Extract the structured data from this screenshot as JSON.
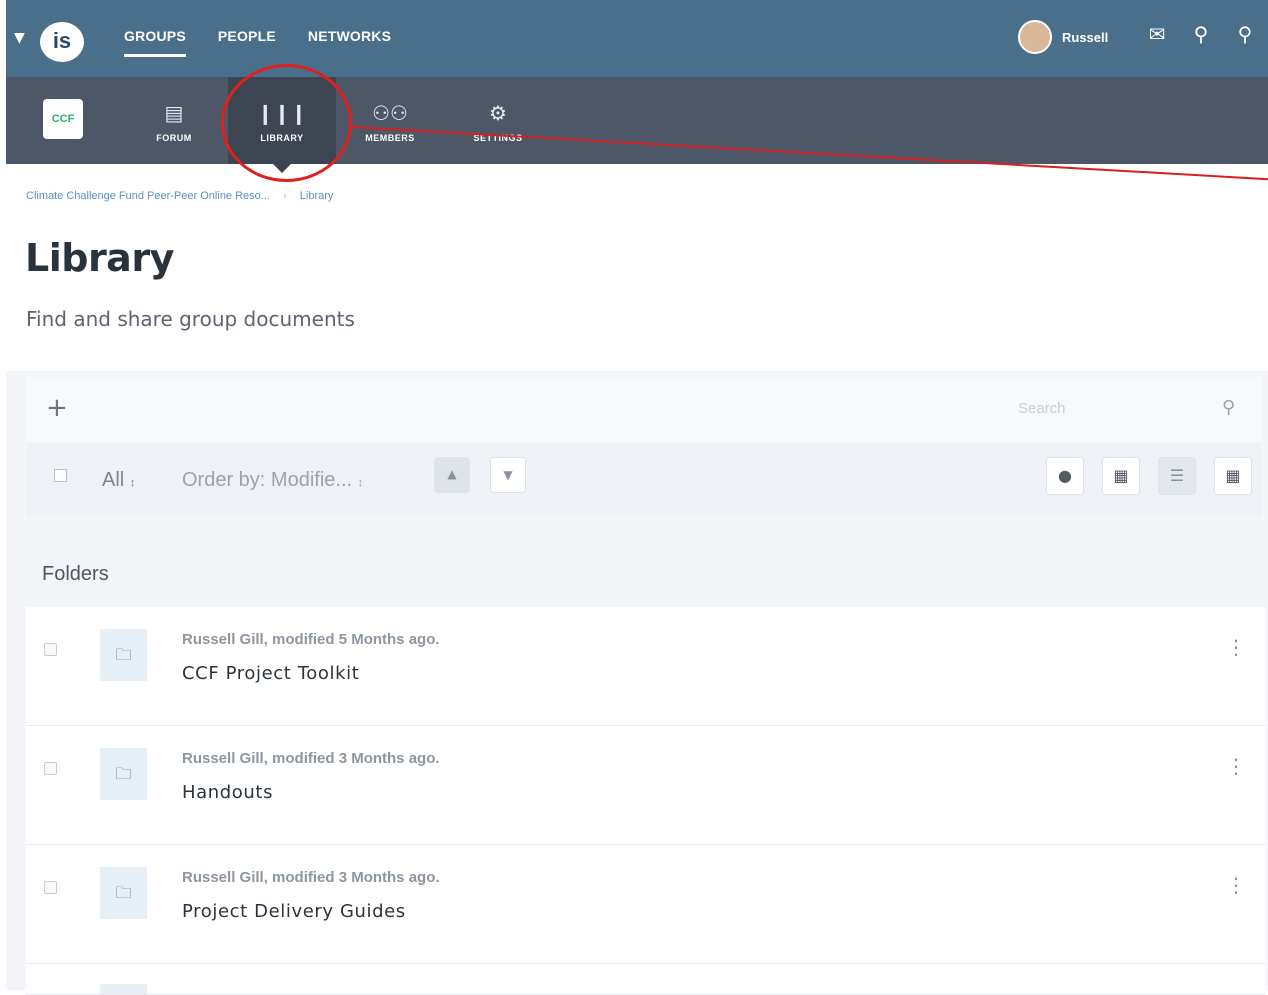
{
  "topbar": {
    "logo_text": "is",
    "nav": [
      "GROUPS",
      "PEOPLE",
      "NETWORKS"
    ],
    "active_nav": "GROUPS",
    "user_name": "Russell",
    "icons": [
      "envelope-icon",
      "bell-icon",
      "search-icon"
    ]
  },
  "groupbar": {
    "logo_text": "CCF",
    "tabs": [
      {
        "label": "FORUM",
        "icon": "forum-icon"
      },
      {
        "label": "LIBRARY",
        "icon": "library-icon"
      },
      {
        "label": "MEMBERS",
        "icon": "members-icon"
      },
      {
        "label": "SETTINGS",
        "icon": "settings-icon"
      }
    ],
    "active_tab": "LIBRARY"
  },
  "breadcrumb": {
    "group": "Climate Challenge Fund Peer-Peer Online Reso...",
    "current": "Library"
  },
  "page": {
    "title": "Library",
    "subtitle": "Find and share group documents"
  },
  "library": {
    "search_placeholder": "Search",
    "filter_all": "All",
    "order_by": "Order by: Modifie...",
    "section_label": "Folders",
    "folders": [
      {
        "meta": "Russell Gill, modified 5 Months ago.",
        "name": "CCF Project Toolkit"
      },
      {
        "meta": "Russell Gill, modified 3 Months ago.",
        "name": "Handouts"
      },
      {
        "meta": "Russell Gill, modified 3 Months ago.",
        "name": "Project Delivery Guides"
      }
    ]
  },
  "colors": {
    "topbar": "#4a6f8a",
    "groupbar": "#4e5767",
    "annotation": "#e0201c",
    "breadcrumb_link": "#5a8fc4"
  }
}
